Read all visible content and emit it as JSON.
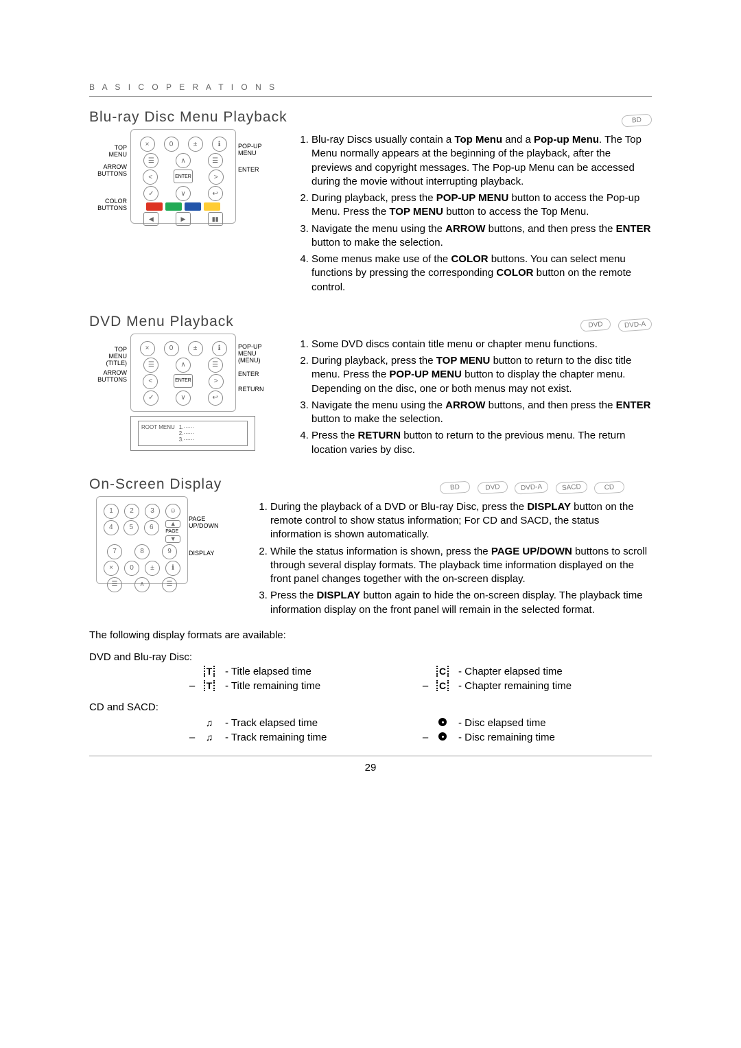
{
  "header": "B A S I C   O P E R A T I O N S",
  "page_number": "29",
  "sections": {
    "bluray": {
      "title": "Blu-ray Disc Menu Playback",
      "pills": [
        "BD"
      ],
      "diagram_labels": {
        "top_menu": "TOP\nMENU",
        "arrow_buttons": "ARROW\nBUTTONS",
        "color_buttons": "COLOR\nBUTTONS",
        "popup_menu": "POP-UP\nMENU",
        "enter": "ENTER"
      },
      "steps": [
        "Blu-ray Discs usually contain a Top Menu and a Pop-up Menu.  The Top Menu normally appears at the beginning of the playback, after the previews and copyright messages.  The Pop-up Menu can be accessed during the movie without interrupting playback.",
        "During playback, press the POP-UP MENU button to access the Pop-up Menu.  Press the TOP MENU button to access the Top Menu.",
        "Navigate the menu using the ARROW buttons, and then press the ENTER button to make the selection.",
        "Some menus make use of the COLOR buttons.  You can select menu functions by pressing the corresponding COLOR button on the remote control."
      ]
    },
    "dvd": {
      "title": "DVD Menu Playback",
      "pills": [
        "DVD",
        "DVD-A"
      ],
      "diagram_labels": {
        "top_menu_title": "TOP\nMENU\n(TITLE)",
        "arrow_buttons": "ARROW\nBUTTONS",
        "popup_menu_menu": "POP-UP\nMENU\n(MENU)",
        "enter": "ENTER",
        "return": "RETURN",
        "root_menu": "ROOT MENU",
        "root_items": "1.······\n2.······\n3.······"
      },
      "steps": [
        "Some DVD discs contain title menu or chapter menu functions.",
        "During playback, press the TOP MENU button to return to the disc title menu. Press the POP-UP MENU button to display the chapter menu.  Depending on the disc, one or both menus may not exist.",
        "Navigate the menu using the ARROW buttons, and then press the ENTER button to make the selection.",
        "Press the RETURN button to return to the previous menu.  The return location varies by disc."
      ]
    },
    "osd": {
      "title": "On-Screen Display",
      "pills": [
        "BD",
        "DVD",
        "DVD-A",
        "SACD",
        "CD"
      ],
      "diagram_labels": {
        "page_updown": "PAGE\nUP/DOWN",
        "display": "DISPLAY"
      },
      "steps": [
        "During the playback of a DVD or Blu-ray Disc, press the DISPLAY button on the remote control to show status information; For CD and SACD, the status information is shown automatically.",
        "While the status information is shown, press the PAGE UP/DOWN buttons to scroll through several display formats.  The playback time information displayed on the front panel changes together with the on-screen display.",
        "Press the DISPLAY button again to hide the on-screen display.  The playback time information display on the front panel will remain in the selected format."
      ],
      "intro_after": "The following display formats are available:"
    },
    "formats": {
      "dvd_bd_label": "DVD and Blu-ray Disc:",
      "cd_sacd_label": "CD and SACD:",
      "dvd_rows": [
        {
          "left_icon": "T",
          "left_text": "- Title elapsed time",
          "right_icon": "C",
          "right_text": "- Chapter elapsed time"
        },
        {
          "left_minus": "–",
          "left_icon": "T",
          "left_text": "- Title remaining time",
          "right_minus": "–",
          "right_icon": "C",
          "right_text": "- Chapter remaining time"
        }
      ],
      "cd_rows": [
        {
          "left_icon": "note",
          "left_text": "- Track elapsed time",
          "right_icon": "disc",
          "right_text": "- Disc elapsed time"
        },
        {
          "left_minus": "–",
          "left_icon": "note",
          "left_text": "- Track remaining time",
          "right_minus": "–",
          "right_icon": "disc",
          "right_text": "- Disc remaining time"
        }
      ]
    }
  }
}
